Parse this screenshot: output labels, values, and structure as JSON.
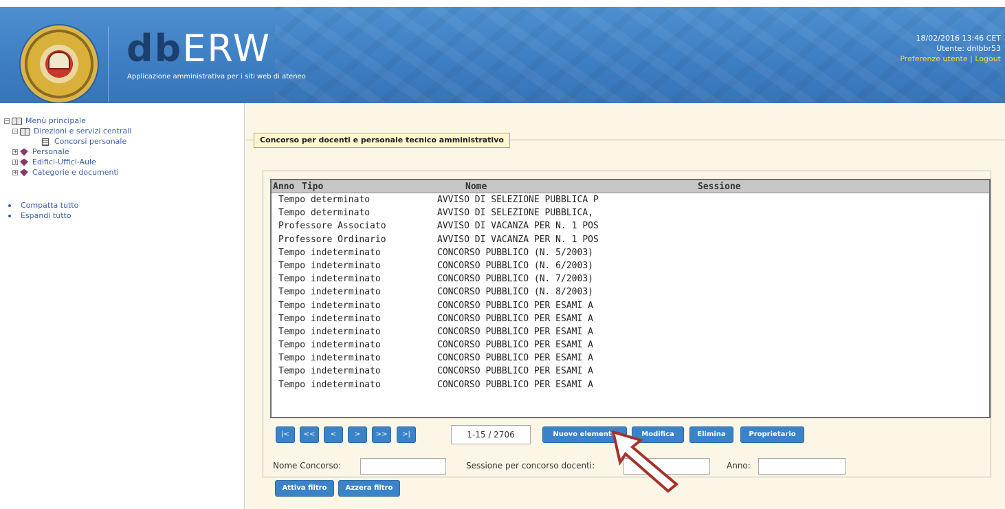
{
  "header": {
    "title_bold": "db",
    "title_light": "ERW",
    "subtitle": "Applicazione amministrativa per i siti web di ateneo",
    "datetime": "18/02/2016 13:46 CET",
    "user": "Utente: dnlbbr53",
    "links": "Preferenze utente | Logout"
  },
  "sidebar": {
    "tree": [
      "Menù principale",
      "Direzioni e servizi centrali",
      "Concorsi personale",
      "Personale",
      "Edifici-Uffici-Aule",
      "Categorie e documenti"
    ],
    "actions": [
      "Compatta tutto",
      "Espandi tutto"
    ]
  },
  "main": {
    "section_title": "Concorso per docenti e personale tecnico amministrativo",
    "columns": [
      "Anno",
      "Tipo",
      "Nome",
      "Sessione"
    ],
    "rows": [
      {
        "tipo": "Tempo determinato",
        "nome": "AVVISO DI SELEZIONE PUBBLICA P"
      },
      {
        "tipo": "Tempo determinato",
        "nome": "AVVISO DI SELEZIONE PUBBLICA,"
      },
      {
        "tipo": "Professore Associato",
        "nome": "AVVISO DI VACANZA PER N. 1 POS"
      },
      {
        "tipo": "Professore Ordinario",
        "nome": "AVVISO DI VACANZA PER N. 1 POS"
      },
      {
        "tipo": "Tempo indeterminato",
        "nome": "CONCORSO PUBBLICO (N. 5/2003)"
      },
      {
        "tipo": "Tempo indeterminato",
        "nome": "CONCORSO PUBBLICO (N. 6/2003)"
      },
      {
        "tipo": "Tempo indeterminato",
        "nome": "CONCORSO PUBBLICO (N. 7/2003)"
      },
      {
        "tipo": "Tempo indeterminato",
        "nome": "CONCORSO PUBBLICO (N. 8/2003)"
      },
      {
        "tipo": "Tempo indeterminato",
        "nome": "CONCORSO PUBBLICO PER ESAMI A"
      },
      {
        "tipo": "Tempo indeterminato",
        "nome": "CONCORSO PUBBLICO PER ESAMI A"
      },
      {
        "tipo": "Tempo indeterminato",
        "nome": "CONCORSO PUBBLICO PER ESAMI A"
      },
      {
        "tipo": "Tempo indeterminato",
        "nome": "CONCORSO PUBBLICO PER ESAMI A"
      },
      {
        "tipo": "Tempo indeterminato",
        "nome": "CONCORSO PUBBLICO PER ESAMI A"
      },
      {
        "tipo": "Tempo indeterminato",
        "nome": "CONCORSO PUBBLICO PER ESAMI A"
      },
      {
        "tipo": "Tempo indeterminato",
        "nome": "CONCORSO PUBBLICO PER ESAMI A"
      }
    ],
    "pager": {
      "first": "|<",
      "prev_page": "<<",
      "prev": "<",
      "next": ">",
      "next_page": ">>",
      "last": ">|",
      "count": "1-15 / 2706"
    },
    "actions": {
      "new": "Nuovo elemento",
      "edit": "Modifica",
      "delete": "Elimina",
      "owner": "Proprietario"
    },
    "filters": {
      "nome_label": "Nome Concorso:",
      "sessione_label": "Sessione per concorso docenti:",
      "anno_label": "Anno:",
      "apply": "Attiva filtro",
      "reset": "Azzera filtro"
    }
  },
  "colors": {
    "header_blue": "#3d7dc2",
    "button_blue": "#3b83c9",
    "panel_bg": "#fbf6e6",
    "arrow_red": "#a5322a"
  }
}
